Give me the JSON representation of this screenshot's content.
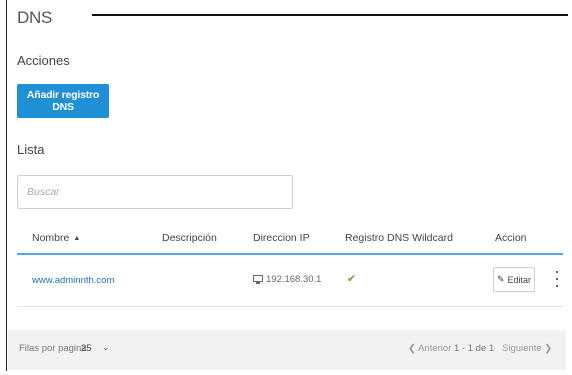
{
  "page": {
    "title": "DNS"
  },
  "actions": {
    "heading": "Acciones",
    "add_button": "Añadir registro DNS"
  },
  "list": {
    "heading": "Lista",
    "search_placeholder": "Buscar"
  },
  "table": {
    "columns": [
      "Nombre",
      "Descripción",
      "Direccion IP",
      "Registro DNS Wildcard",
      "Accion"
    ],
    "sort_column": "Nombre",
    "rows": [
      {
        "nombre": "www.adminnth.com",
        "descripcion": "",
        "ip": "192.168.30.1",
        "wildcard_check": "✔",
        "edit_label": "Editar"
      }
    ]
  },
  "footer": {
    "rows_per_page_label": "Filas por pagina",
    "rows_per_page_value": "25",
    "prev_label": "❮ Anterior",
    "page_info": "1 - 1 de 1",
    "next_label": "Siguiente ❯"
  },
  "colors": {
    "accent": "#1f8fd6",
    "link": "#1f6fb8",
    "check": "#6aa53a",
    "header_border": "#5aa7dd"
  }
}
